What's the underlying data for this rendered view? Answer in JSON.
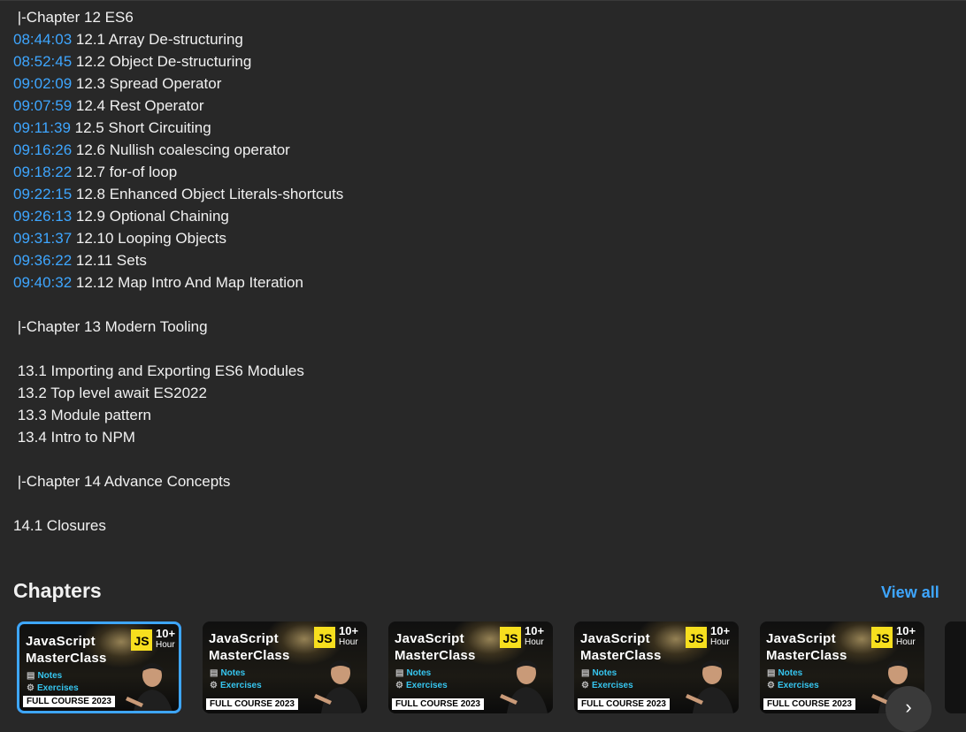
{
  "description": {
    "lines": [
      {
        "ts": "",
        "text": " |-Chapter 12 ES6"
      },
      {
        "ts": "08:44:03",
        "text": " 12.1 Array De-structuring"
      },
      {
        "ts": "08:52:45",
        "text": " 12.2 Object De-structuring"
      },
      {
        "ts": "09:02:09",
        "text": " 12.3 Spread Operator"
      },
      {
        "ts": "09:07:59",
        "text": " 12.4 Rest Operator"
      },
      {
        "ts": "09:11:39",
        "text": " 12.5 Short Circuiting"
      },
      {
        "ts": "09:16:26",
        "text": " 12.6 Nullish coalescing operator"
      },
      {
        "ts": "09:18:22",
        "text": " 12.7 for-of loop"
      },
      {
        "ts": "09:22:15",
        "text": " 12.8 Enhanced Object Literals-shortcuts"
      },
      {
        "ts": "09:26:13",
        "text": " 12.9 Optional Chaining"
      },
      {
        "ts": "09:31:37",
        "text": " 12.10 Looping Objects"
      },
      {
        "ts": "09:36:22",
        "text": " 12.11 Sets"
      },
      {
        "ts": "09:40:32",
        "text": " 12.12 Map Intro And Map Iteration"
      },
      {
        "ts": "",
        "text": ""
      },
      {
        "ts": "",
        "text": " |-Chapter 13 Modern Tooling"
      },
      {
        "ts": "",
        "text": ""
      },
      {
        "ts": "",
        "text": " 13.1 Importing and Exporting ES6 Modules"
      },
      {
        "ts": "",
        "text": " 13.2 Top level await ES2022"
      },
      {
        "ts": "",
        "text": " 13.3 Module pattern"
      },
      {
        "ts": "",
        "text": " 13.4 Intro to NPM"
      },
      {
        "ts": "",
        "text": ""
      },
      {
        "ts": "",
        "text": " |-Chapter 14 Advance Concepts"
      },
      {
        "ts": "",
        "text": ""
      },
      {
        "ts": "",
        "text": "14.1 Closures"
      }
    ]
  },
  "chapters": {
    "title": "Chapters",
    "view_all": "View all",
    "thumbnail": {
      "title_line1": "JavaScript",
      "title_line2": "MasterClass",
      "js_badge": "JS",
      "hours": "10+",
      "hours_unit": "Hour",
      "notes": "Notes",
      "exercises": "Exercises",
      "banner": "FULL COURSE 2023"
    },
    "count": 5,
    "next_icon": "chevron-right-icon"
  }
}
